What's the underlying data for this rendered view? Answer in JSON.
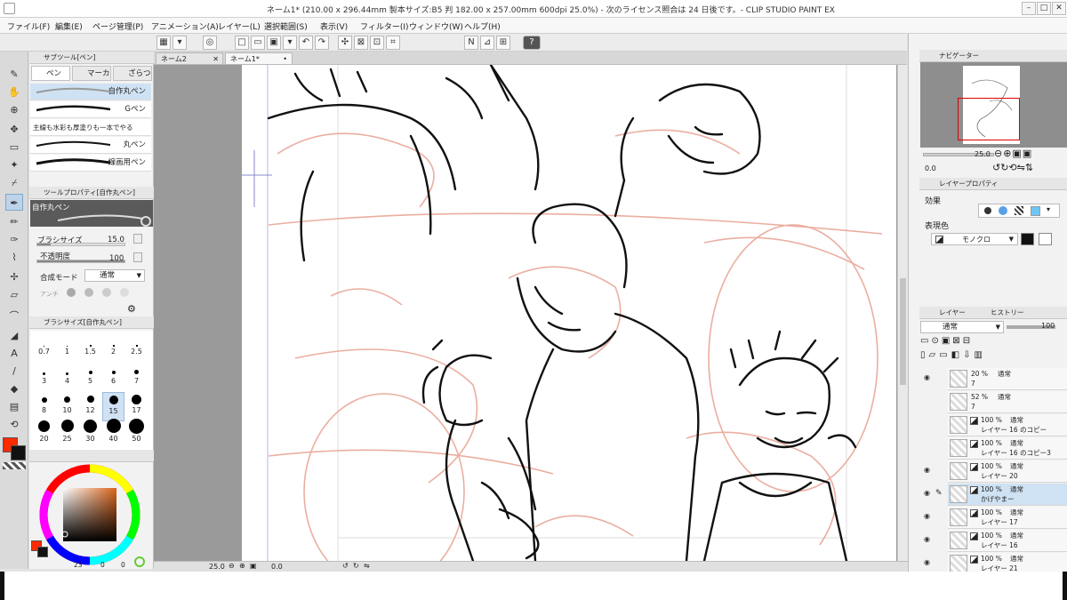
{
  "window": {
    "title": "ネーム1* (210.00 x 296.44mm 製本サイズ:B5 判 182.00 x 257.00mm 600dpi 25.0%) - 次のライセンス照合は 24 日後です。- CLIP STUDIO PAINT EX",
    "min": "–",
    "max": "□",
    "close": "✕"
  },
  "menu": [
    "ファイル(F)",
    "編集(E)",
    "ページ管理(P)",
    "アニメーション(A)",
    "レイヤー(L)",
    "選択範囲(S)",
    "表示(V)",
    "フィルター(I)",
    "ウィンドウ(W)",
    "ヘルプ(H)"
  ],
  "command_icons": [
    "grid-icon",
    "grid-dropdown-icon",
    "spiral-icon",
    "new-file-icon",
    "open-folder-icon",
    "save-icon",
    "save-dropdown-icon",
    "undo-icon",
    "redo-icon",
    "transform-icon",
    "deselect-icon",
    "invert-selection-icon",
    "crop-icon",
    "ruler-icon",
    "ruler-perspective-icon",
    "ruler-grid-icon",
    "help-icon"
  ],
  "command_glyphs": [
    "▦",
    "▾",
    "◎",
    "□",
    "▭",
    "▣",
    "▾",
    "↶",
    "↷",
    "✣",
    "⊠",
    "⊡",
    "⌗",
    "N",
    "⊿",
    "⊞",
    "?"
  ],
  "tools": [
    {
      "name": "pen",
      "glyph": "✎"
    },
    {
      "name": "hand",
      "glyph": "✋"
    },
    {
      "name": "zoom",
      "glyph": "⊕"
    },
    {
      "name": "move",
      "glyph": "✥"
    },
    {
      "name": "select",
      "glyph": "▭"
    },
    {
      "name": "auto-select",
      "glyph": "✦"
    },
    {
      "name": "eyedropper",
      "glyph": "⌿"
    },
    {
      "name": "pen-active",
      "glyph": "✒"
    },
    {
      "name": "pencil",
      "glyph": "✏"
    },
    {
      "name": "brush",
      "glyph": "✑"
    },
    {
      "name": "airbrush",
      "glyph": "⌇"
    },
    {
      "name": "decoration",
      "glyph": "✢"
    },
    {
      "name": "eraser",
      "glyph": "▱"
    },
    {
      "name": "blend",
      "glyph": "⌒"
    },
    {
      "name": "fill",
      "glyph": "◢"
    },
    {
      "name": "text",
      "glyph": "A"
    },
    {
      "name": "line",
      "glyph": "/"
    },
    {
      "name": "droplet",
      "glyph": "◆"
    },
    {
      "name": "gradient",
      "glyph": "▤"
    },
    {
      "name": "correct",
      "glyph": "⟲"
    }
  ],
  "subtool": {
    "header": "サブツール[ペン]",
    "tabs": [
      "ペン",
      "マーカ",
      "ざらつ"
    ],
    "brushes": [
      "自作丸ペン",
      "Gペン",
      "主線も水彩も厚塗りも一本でやる",
      "丸ペン",
      "線画用ペン"
    ]
  },
  "tool_property": {
    "header": "ツールプロパティ[自作丸ペン]",
    "brush_name": "自作丸ペン",
    "rows": [
      {
        "label": "ブラシサイズ",
        "value": "15.0"
      },
      {
        "label": "不透明度",
        "value": "100"
      },
      {
        "label": "合成モード",
        "value": "通常"
      },
      {
        "label": "アンチ"
      }
    ],
    "size_fraction": 0.15,
    "opacity_fraction": 1.0
  },
  "brush_size": {
    "header": "ブラシサイズ[自作丸ペン]",
    "sizes": [
      "0.7",
      "1",
      "1.5",
      "2",
      "2.5",
      "3",
      "4",
      "5",
      "6",
      "7",
      "8",
      "10",
      "12",
      "15",
      "17",
      "20",
      "25",
      "30",
      "40",
      "50"
    ],
    "selected": "15"
  },
  "color_wheel": {
    "header": "",
    "status": [
      "23",
      "0",
      "0"
    ],
    "main_color": "#ff2a00",
    "sub_color": "#111111",
    "center_color": "#b06633"
  },
  "documents": {
    "tabs": [
      "ネーム2",
      "ネーム1*"
    ],
    "active": "ネーム1*"
  },
  "bottom": {
    "zoom": "25.0",
    "angle": "0.0"
  },
  "navigator": {
    "tab": "ナビゲーター",
    "zoom": "25.0",
    "angle": "0.0"
  },
  "layer_property": {
    "tab": "レイヤープロパティ",
    "effect_label": "効果",
    "expression_label": "表現色",
    "expression_value": "モノクロ"
  },
  "layers": {
    "tabs": [
      "レイヤー",
      "ヒストリー"
    ],
    "blend_mode": "通常",
    "opacity": "100",
    "items": [
      {
        "percent": "20 %",
        "mode": "通常",
        "name": "7",
        "visible": true,
        "sel": false,
        "mono": false
      },
      {
        "percent": "52 %",
        "mode": "通常",
        "name": "7",
        "visible": false,
        "sel": false,
        "mono": false
      },
      {
        "percent": "100 %",
        "mode": "通常",
        "name": "レイヤー 16 のコピー",
        "visible": false,
        "sel": false,
        "mono": true
      },
      {
        "percent": "100 %",
        "mode": "通常",
        "name": "レイヤー 16 のコピー3",
        "visible": false,
        "sel": false,
        "mono": true
      },
      {
        "percent": "100 %",
        "mode": "通常",
        "name": "レイヤー 20",
        "visible": true,
        "sel": false,
        "mono": true
      },
      {
        "percent": "100 %",
        "mode": "通常",
        "name": "かげやまー",
        "visible": true,
        "sel": true,
        "mono": true
      },
      {
        "percent": "100 %",
        "mode": "通常",
        "name": "レイヤー 17",
        "visible": true,
        "sel": false,
        "mono": true
      },
      {
        "percent": "100 %",
        "mode": "通常",
        "name": "レイヤー 16",
        "visible": true,
        "sel": false,
        "mono": true
      },
      {
        "percent": "100 %",
        "mode": "通常",
        "name": "レイヤー 21",
        "visible": true,
        "sel": false,
        "mono": true
      }
    ]
  },
  "colors": {
    "accent": "#cfe2f3",
    "sketch": "#e8a090",
    "ink": "#111111",
    "selection": "#e00000"
  }
}
